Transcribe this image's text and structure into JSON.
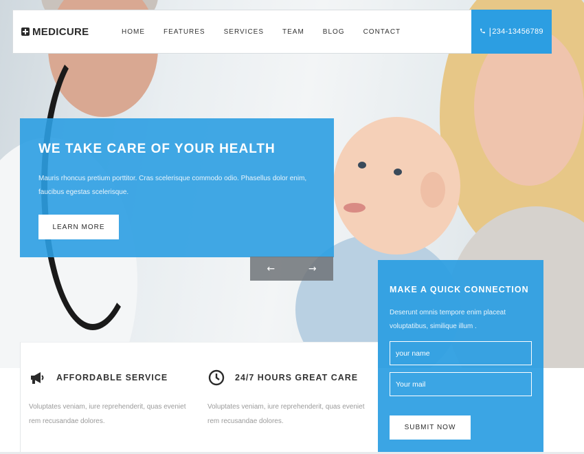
{
  "navbar": {
    "brand": "MEDICURE",
    "brand_icon": "medical-cross-icon",
    "menu": [
      "HOME",
      "FEATURES",
      "SERVICES",
      "TEAM",
      "BLOG",
      "CONTACT"
    ],
    "phone_icon": "phone-icon",
    "phone_separator": "|",
    "phone": "234-13456789"
  },
  "hero": {
    "title": "WE TAKE CARE OF YOUR HEALTH",
    "text": "Mauris rhoncus pretium porttitor. Cras scelerisque commodo odio. Phasellus dolor enim, faucibus egestas scelerisque.",
    "button": "LEARN MORE",
    "prev_arrow": "←",
    "next_arrow": "→"
  },
  "features": [
    {
      "icon": "megaphone-icon",
      "title": "AFFORDABLE SERVICE",
      "text": "Voluptates veniam, iure reprehenderit, quas eveniet rem recusandae dolores."
    },
    {
      "icon": "clock-icon",
      "title": "24/7 HOURS GREAT CARE",
      "text": "Voluptates veniam, iure reprehenderit, quas eveniet rem recusandae dolores."
    }
  ],
  "contact": {
    "title": "MAKE A QUICK CONNECTION",
    "text": "Deserunt omnis tempore enim placeat voluptatibus, similique illum .",
    "name_placeholder": "your name",
    "mail_placeholder": "Your mail",
    "submit": "SUBMIT NOW"
  },
  "colors": {
    "accent": "#2c9ee2",
    "slider_nav": "#6e7378",
    "text_dark": "#333333",
    "text_muted": "#9a9a9a"
  }
}
